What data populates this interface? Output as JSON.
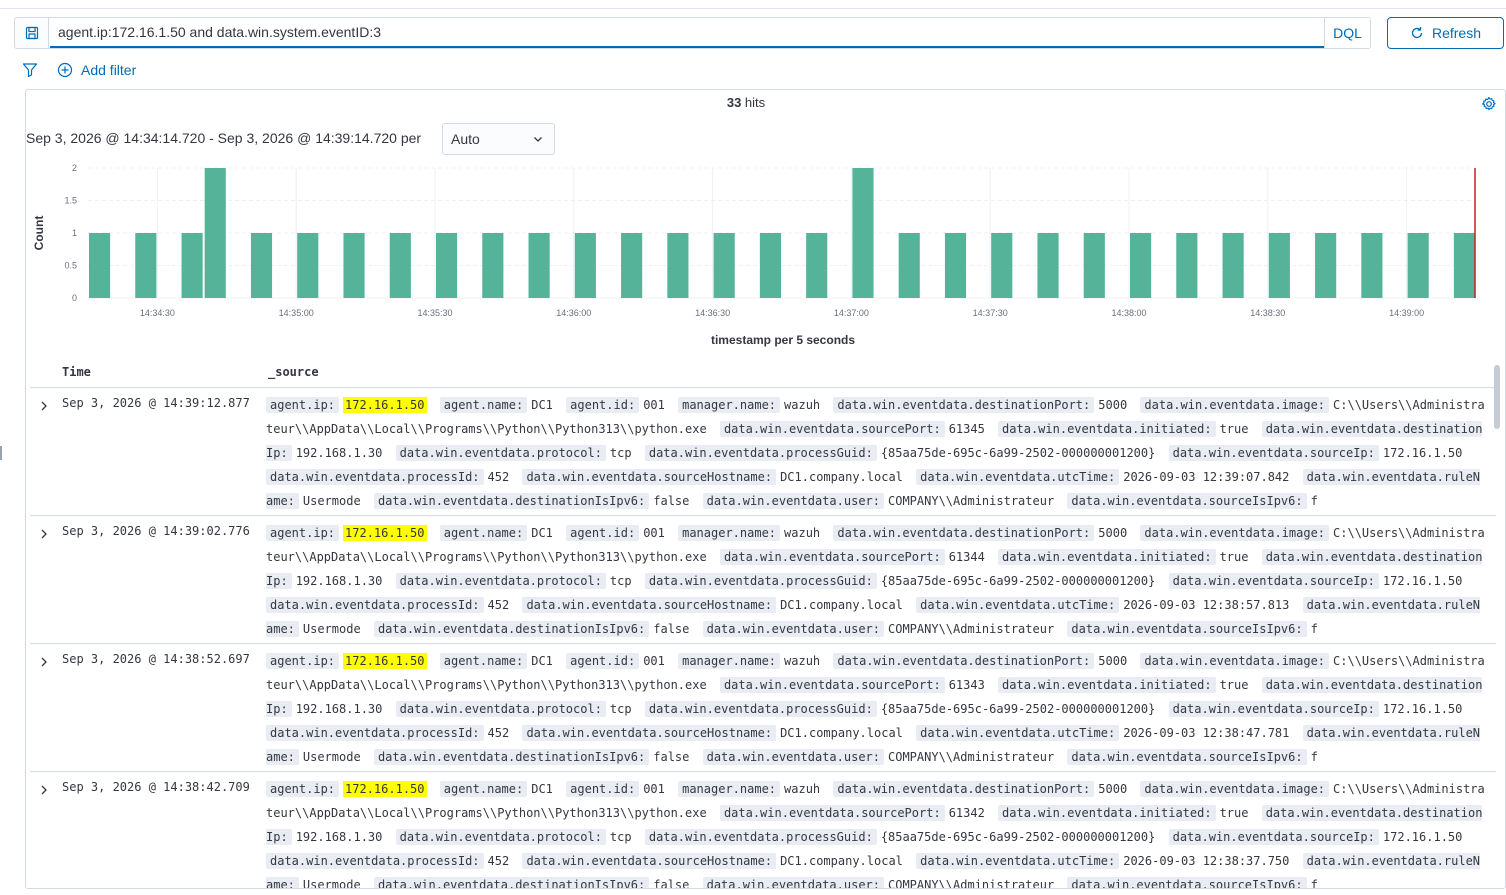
{
  "query": {
    "value": "agent.ip:172.16.1.50 and data.win.system.eventID:3",
    "language": "DQL"
  },
  "toolbar": {
    "refresh_label": "Refresh",
    "add_filter_label": "Add filter"
  },
  "summary": {
    "hits_count": "33",
    "hits_label": " hits"
  },
  "time_range": {
    "text": "Sep 3, 2026 @ 14:34:14.720 - Sep 3, 2026 @ 14:39:14.720 per",
    "interval": "Auto"
  },
  "colors": {
    "bar": "#54b399",
    "accent": "#006bb8",
    "now_marker": "#bd271e"
  },
  "chart_data": {
    "type": "bar",
    "xlabel": "timestamp per 5 seconds",
    "ylabel": "Count",
    "ylim": [
      0,
      2
    ],
    "yticks": [
      0,
      0.5,
      1,
      1.5,
      2
    ],
    "xlim": [
      "14:34:15",
      "14:39:15"
    ],
    "xticks": [
      "14:34:30",
      "14:35:00",
      "14:35:30",
      "14:36:00",
      "14:36:30",
      "14:37:00",
      "14:37:30",
      "14:38:00",
      "14:38:30",
      "14:39:00"
    ],
    "grid": true,
    "x": [
      "14:34:15",
      "14:34:25",
      "14:34:35",
      "14:34:40",
      "14:34:50",
      "14:35:00",
      "14:35:10",
      "14:35:20",
      "14:35:30",
      "14:35:40",
      "14:35:50",
      "14:36:00",
      "14:36:10",
      "14:36:20",
      "14:36:30",
      "14:36:40",
      "14:36:50",
      "14:37:00",
      "14:37:10",
      "14:37:20",
      "14:37:30",
      "14:37:40",
      "14:37:50",
      "14:38:00",
      "14:38:10",
      "14:38:20",
      "14:38:30",
      "14:38:40",
      "14:38:50",
      "14:39:00",
      "14:39:10"
    ],
    "values": [
      1,
      1,
      1,
      2,
      1,
      1,
      1,
      1,
      1,
      1,
      1,
      1,
      1,
      1,
      1,
      1,
      1,
      2,
      1,
      1,
      1,
      1,
      1,
      1,
      1,
      1,
      1,
      1,
      1,
      1,
      1
    ]
  },
  "table": {
    "columns": [
      "Time",
      "_source"
    ],
    "rows": [
      {
        "time": "Sep 3, 2026 @ 14:39:12.877",
        "fields": [
          {
            "k": "agent.ip:",
            "v": "172.16.1.50",
            "hl": true
          },
          {
            "k": "agent.name:",
            "v": "DC1"
          },
          {
            "k": "agent.id:",
            "v": "001"
          },
          {
            "k": "manager.name:",
            "v": "wazuh"
          },
          {
            "k": "data.win.eventdata.destinationPort:",
            "v": "5000"
          },
          {
            "k": "data.win.eventdata.image:",
            "v": "C:\\\\Users\\\\Administrateur\\\\AppData\\\\Local\\\\Programs\\\\Python\\\\Python313\\\\python.exe"
          },
          {
            "k": "data.win.eventdata.sourcePort:",
            "v": "61345"
          },
          {
            "k": "data.win.eventdata.initiated:",
            "v": "true"
          },
          {
            "k": "data.win.eventdata.destinationIp:",
            "v": "192.168.1.30"
          },
          {
            "k": "data.win.eventdata.protocol:",
            "v": "tcp"
          },
          {
            "k": "data.win.eventdata.processGuid:",
            "v": "{85aa75de-695c-6a99-2502-000000001200}"
          },
          {
            "k": "data.win.eventdata.sourceIp:",
            "v": "172.16.1.50"
          },
          {
            "k": "data.win.eventdata.processId:",
            "v": "452"
          },
          {
            "k": "data.win.eventdata.sourceHostname:",
            "v": "DC1.company.local"
          },
          {
            "k": "data.win.eventdata.utcTime:",
            "v": "2026-09-03 12:39:07.842"
          },
          {
            "k": "data.win.eventdata.ruleName:",
            "v": "Usermode"
          },
          {
            "k": "data.win.eventdata.destinationIsIpv6:",
            "v": "false"
          },
          {
            "k": "data.win.eventdata.user:",
            "v": "COMPANY\\\\Administrateur"
          },
          {
            "k": "data.win.eventdata.sourceIsIpv6:",
            "v": "f"
          }
        ]
      },
      {
        "time": "Sep 3, 2026 @ 14:39:02.776",
        "fields": [
          {
            "k": "agent.ip:",
            "v": "172.16.1.50",
            "hl": true
          },
          {
            "k": "agent.name:",
            "v": "DC1"
          },
          {
            "k": "agent.id:",
            "v": "001"
          },
          {
            "k": "manager.name:",
            "v": "wazuh"
          },
          {
            "k": "data.win.eventdata.destinationPort:",
            "v": "5000"
          },
          {
            "k": "data.win.eventdata.image:",
            "v": "C:\\\\Users\\\\Administrateur\\\\AppData\\\\Local\\\\Programs\\\\Python\\\\Python313\\\\python.exe"
          },
          {
            "k": "data.win.eventdata.sourcePort:",
            "v": "61344"
          },
          {
            "k": "data.win.eventdata.initiated:",
            "v": "true"
          },
          {
            "k": "data.win.eventdata.destinationIp:",
            "v": "192.168.1.30"
          },
          {
            "k": "data.win.eventdata.protocol:",
            "v": "tcp"
          },
          {
            "k": "data.win.eventdata.processGuid:",
            "v": "{85aa75de-695c-6a99-2502-000000001200}"
          },
          {
            "k": "data.win.eventdata.sourceIp:",
            "v": "172.16.1.50"
          },
          {
            "k": "data.win.eventdata.processId:",
            "v": "452"
          },
          {
            "k": "data.win.eventdata.sourceHostname:",
            "v": "DC1.company.local"
          },
          {
            "k": "data.win.eventdata.utcTime:",
            "v": "2026-09-03 12:38:57.813"
          },
          {
            "k": "data.win.eventdata.ruleName:",
            "v": "Usermode"
          },
          {
            "k": "data.win.eventdata.destinationIsIpv6:",
            "v": "false"
          },
          {
            "k": "data.win.eventdata.user:",
            "v": "COMPANY\\\\Administrateur"
          },
          {
            "k": "data.win.eventdata.sourceIsIpv6:",
            "v": "f"
          }
        ]
      },
      {
        "time": "Sep 3, 2026 @ 14:38:52.697",
        "fields": [
          {
            "k": "agent.ip:",
            "v": "172.16.1.50",
            "hl": true
          },
          {
            "k": "agent.name:",
            "v": "DC1"
          },
          {
            "k": "agent.id:",
            "v": "001"
          },
          {
            "k": "manager.name:",
            "v": "wazuh"
          },
          {
            "k": "data.win.eventdata.destinationPort:",
            "v": "5000"
          },
          {
            "k": "data.win.eventdata.image:",
            "v": "C:\\\\Users\\\\Administrateur\\\\AppData\\\\Local\\\\Programs\\\\Python\\\\Python313\\\\python.exe"
          },
          {
            "k": "data.win.eventdata.sourcePort:",
            "v": "61343"
          },
          {
            "k": "data.win.eventdata.initiated:",
            "v": "true"
          },
          {
            "k": "data.win.eventdata.destinationIp:",
            "v": "192.168.1.30"
          },
          {
            "k": "data.win.eventdata.protocol:",
            "v": "tcp"
          },
          {
            "k": "data.win.eventdata.processGuid:",
            "v": "{85aa75de-695c-6a99-2502-000000001200}"
          },
          {
            "k": "data.win.eventdata.sourceIp:",
            "v": "172.16.1.50"
          },
          {
            "k": "data.win.eventdata.processId:",
            "v": "452"
          },
          {
            "k": "data.win.eventdata.sourceHostname:",
            "v": "DC1.company.local"
          },
          {
            "k": "data.win.eventdata.utcTime:",
            "v": "2026-09-03 12:38:47.781"
          },
          {
            "k": "data.win.eventdata.ruleName:",
            "v": "Usermode"
          },
          {
            "k": "data.win.eventdata.destinationIsIpv6:",
            "v": "false"
          },
          {
            "k": "data.win.eventdata.user:",
            "v": "COMPANY\\\\Administrateur"
          },
          {
            "k": "data.win.eventdata.sourceIsIpv6:",
            "v": "f"
          }
        ]
      },
      {
        "time": "Sep 3, 2026 @ 14:38:42.709",
        "fields": [
          {
            "k": "agent.ip:",
            "v": "172.16.1.50",
            "hl": true
          },
          {
            "k": "agent.name:",
            "v": "DC1"
          },
          {
            "k": "agent.id:",
            "v": "001"
          },
          {
            "k": "manager.name:",
            "v": "wazuh"
          },
          {
            "k": "data.win.eventdata.destinationPort:",
            "v": "5000"
          },
          {
            "k": "data.win.eventdata.image:",
            "v": "C:\\\\Users\\\\Administrateur\\\\AppData\\\\Local\\\\Programs\\\\Python\\\\Python313\\\\python.exe"
          },
          {
            "k": "data.win.eventdata.sourcePort:",
            "v": "61342"
          },
          {
            "k": "data.win.eventdata.initiated:",
            "v": "true"
          },
          {
            "k": "data.win.eventdata.destinationIp:",
            "v": "192.168.1.30"
          },
          {
            "k": "data.win.eventdata.protocol:",
            "v": "tcp"
          },
          {
            "k": "data.win.eventdata.processGuid:",
            "v": "{85aa75de-695c-6a99-2502-000000001200}"
          },
          {
            "k": "data.win.eventdata.sourceIp:",
            "v": "172.16.1.50"
          },
          {
            "k": "data.win.eventdata.processId:",
            "v": "452"
          },
          {
            "k": "data.win.eventdata.sourceHostname:",
            "v": "DC1.company.local"
          },
          {
            "k": "data.win.eventdata.utcTime:",
            "v": "2026-09-03 12:38:37.750"
          },
          {
            "k": "data.win.eventdata.ruleName:",
            "v": "Usermode"
          },
          {
            "k": "data.win.eventdata.destinationIsIpv6:",
            "v": "false"
          },
          {
            "k": "data.win.eventdata.user:",
            "v": "COMPANY\\\\Administrateur"
          },
          {
            "k": "data.win.eventdata.sourceIsIpv6:",
            "v": "f"
          }
        ]
      }
    ]
  }
}
